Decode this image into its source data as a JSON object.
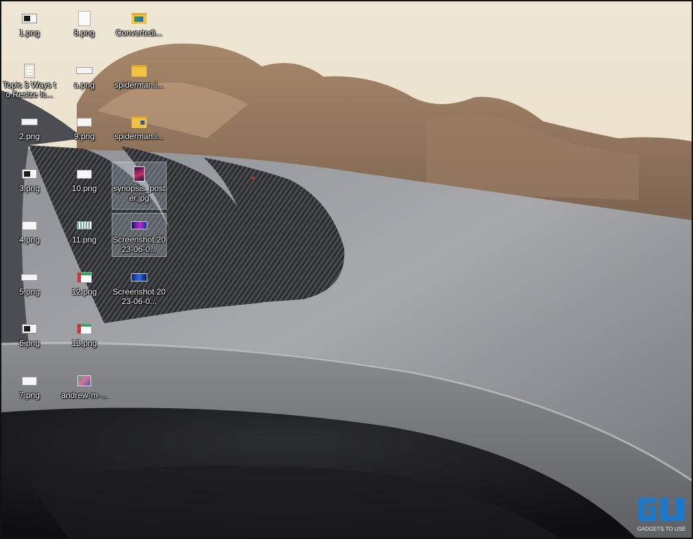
{
  "desktop": {
    "icons": [
      {
        "label": "1.png",
        "thumb": "img-dark"
      },
      {
        "label": "Topic 3 Ways to Resize Ic...",
        "thumb": "doc"
      },
      {
        "label": "2.png",
        "thumb": "img-wide"
      },
      {
        "label": "3.png",
        "thumb": "img-dark"
      },
      {
        "label": "4.png",
        "thumb": "img-w"
      },
      {
        "label": "5.png",
        "thumb": "img-wide"
      },
      {
        "label": "6.png",
        "thumb": "img-dark"
      },
      {
        "label": "7.png",
        "thumb": "img-w"
      },
      {
        "label": "8.png",
        "thumb": "doc-plain"
      },
      {
        "label": "a.png",
        "thumb": "img-wide"
      },
      {
        "label": "9.png",
        "thumb": "img-w"
      },
      {
        "label": "10.png",
        "thumb": "img-w"
      },
      {
        "label": "11.png",
        "thumb": "img-bars"
      },
      {
        "label": "12.png",
        "thumb": "img-col"
      },
      {
        "label": "13.png",
        "thumb": "img-col"
      },
      {
        "label": "andrew-m-...",
        "thumb": "photo"
      },
      {
        "label": "Convertedi...",
        "thumb": "converted"
      },
      {
        "label": "spiderman.i...",
        "thumb": "folder"
      },
      {
        "label": "spiderman.i...",
        "thumb": "folder alt"
      },
      {
        "label": "synopsis_poster.jpg",
        "thumb": "poster",
        "selected": true
      },
      {
        "label": "Screenshot 2023-06-0...",
        "thumb": "shot",
        "selected": true
      },
      {
        "label": "Screenshot 2023-06-0...",
        "thumb": "shot b"
      }
    ]
  },
  "watermark": {
    "text": "GADGETS TO USE",
    "color": "#1e78c8"
  }
}
